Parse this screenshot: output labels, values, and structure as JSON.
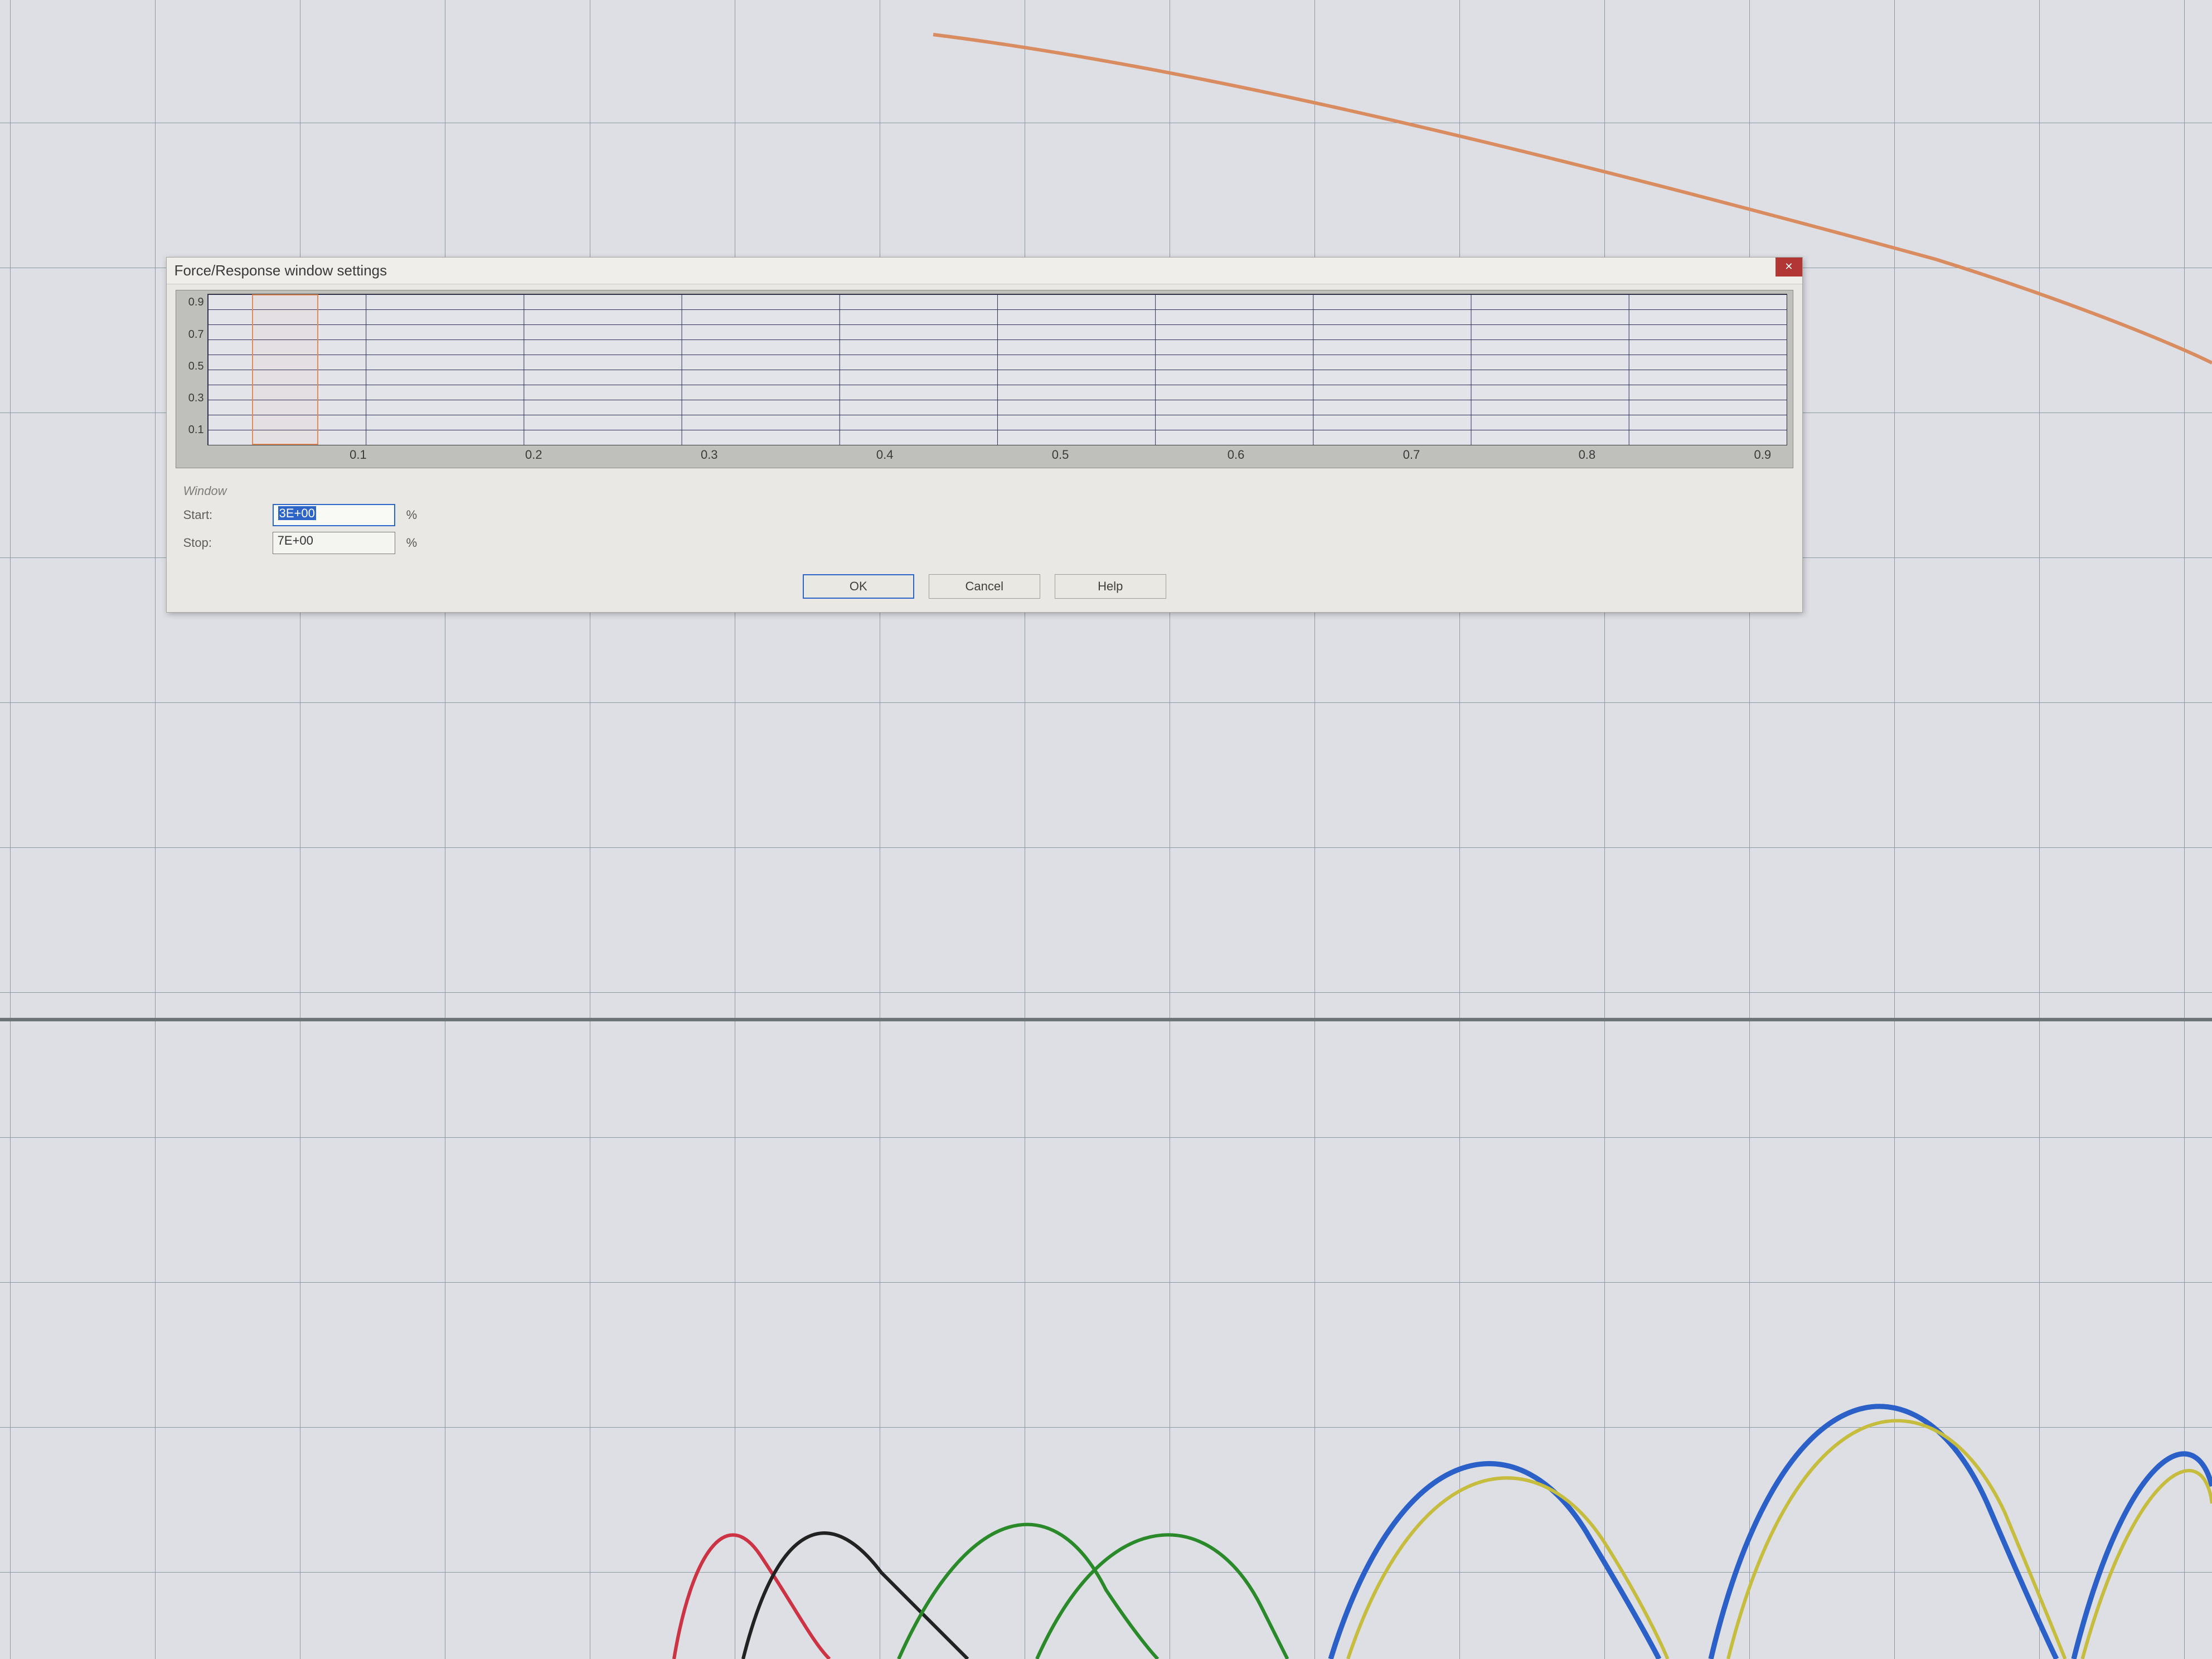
{
  "dialog": {
    "title": "Force/Response window settings",
    "close_glyph": "✕",
    "plot": {
      "y_ticks": [
        "0.9",
        "0.7",
        "0.5",
        "0.3",
        "0.1"
      ],
      "x_ticks": [
        "0.1",
        "0.2",
        "0.3",
        "0.4",
        "0.5",
        "0.6",
        "0.7",
        "0.8",
        "0.9"
      ],
      "selection_start_frac": 0.03,
      "selection_end_frac": 0.07
    },
    "group_title": "Window",
    "fields": {
      "start": {
        "label": "Start:",
        "value": "3E+00",
        "unit": "%"
      },
      "stop": {
        "label": "Stop:",
        "value": "7E+00",
        "unit": "%"
      }
    },
    "buttons": {
      "ok": "OK",
      "cancel": "Cancel",
      "help": "Help"
    }
  },
  "chart_data": {
    "type": "area",
    "title": "",
    "xlabel": "",
    "ylabel": "",
    "xlim": [
      0,
      1
    ],
    "ylim": [
      0,
      1
    ],
    "x_ticks": [
      0.1,
      0.2,
      0.3,
      0.4,
      0.5,
      0.6,
      0.7,
      0.8,
      0.9
    ],
    "y_ticks": [
      0.1,
      0.3,
      0.5,
      0.7,
      0.9
    ],
    "window": {
      "start_pct": 3,
      "stop_pct": 7
    }
  }
}
